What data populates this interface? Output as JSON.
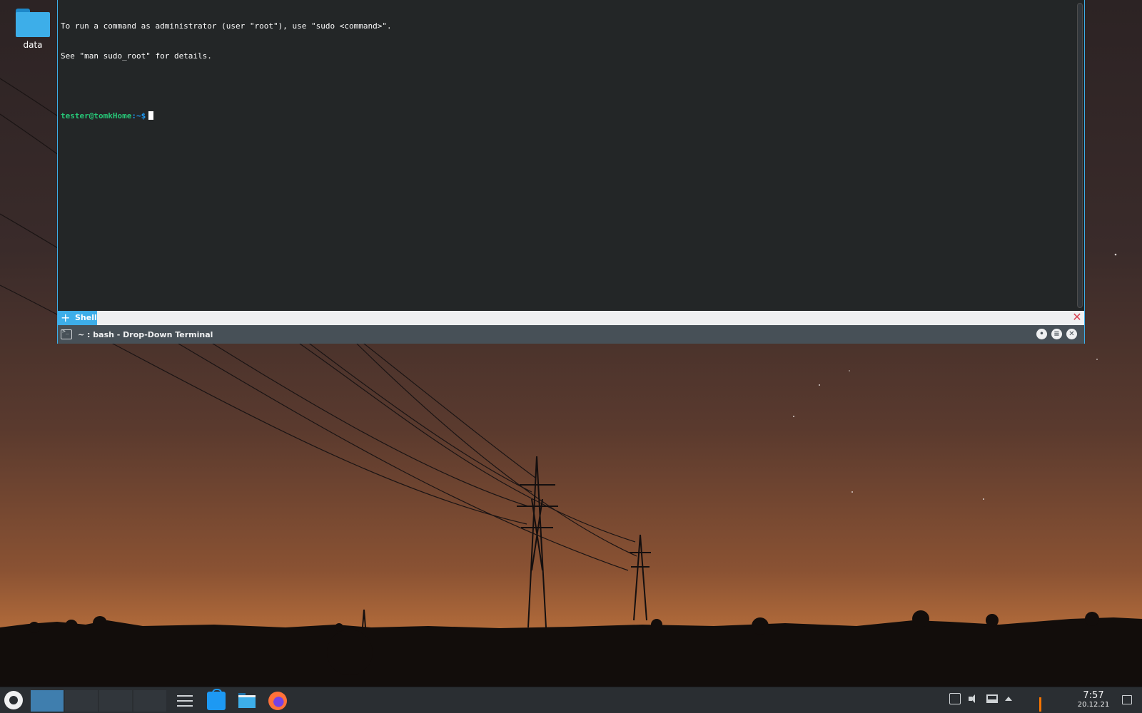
{
  "desktop": {
    "icons": [
      {
        "label": "data",
        "icon": "folder-icon"
      }
    ]
  },
  "terminal": {
    "lines": [
      "To run a command as administrator (user \"root\"), use \"sudo <command>\".",
      "See \"man sudo_root\" for details."
    ],
    "prompt": {
      "user_host": "tester@tomkHome",
      "path": ":~$"
    },
    "tabs": [
      {
        "label": "Shell"
      }
    ],
    "window_title": "~ : bash - Drop-Down Terminal",
    "colors": {
      "background": "#232627",
      "accent": "#3daee9",
      "user_prompt": "#27c878"
    }
  },
  "taskbar": {
    "pager": {
      "desktops": 4,
      "active": 1
    },
    "apps": [
      {
        "name": "system-settings-icon"
      },
      {
        "name": "discover-store-icon"
      },
      {
        "name": "dolphin-files-icon"
      },
      {
        "name": "firefox-icon"
      }
    ],
    "tray": [
      "terminal-icon",
      "volume-icon",
      "network-icon",
      "tray-expand-icon"
    ],
    "clock": {
      "time": "7:57",
      "date": "20.12.21"
    }
  }
}
